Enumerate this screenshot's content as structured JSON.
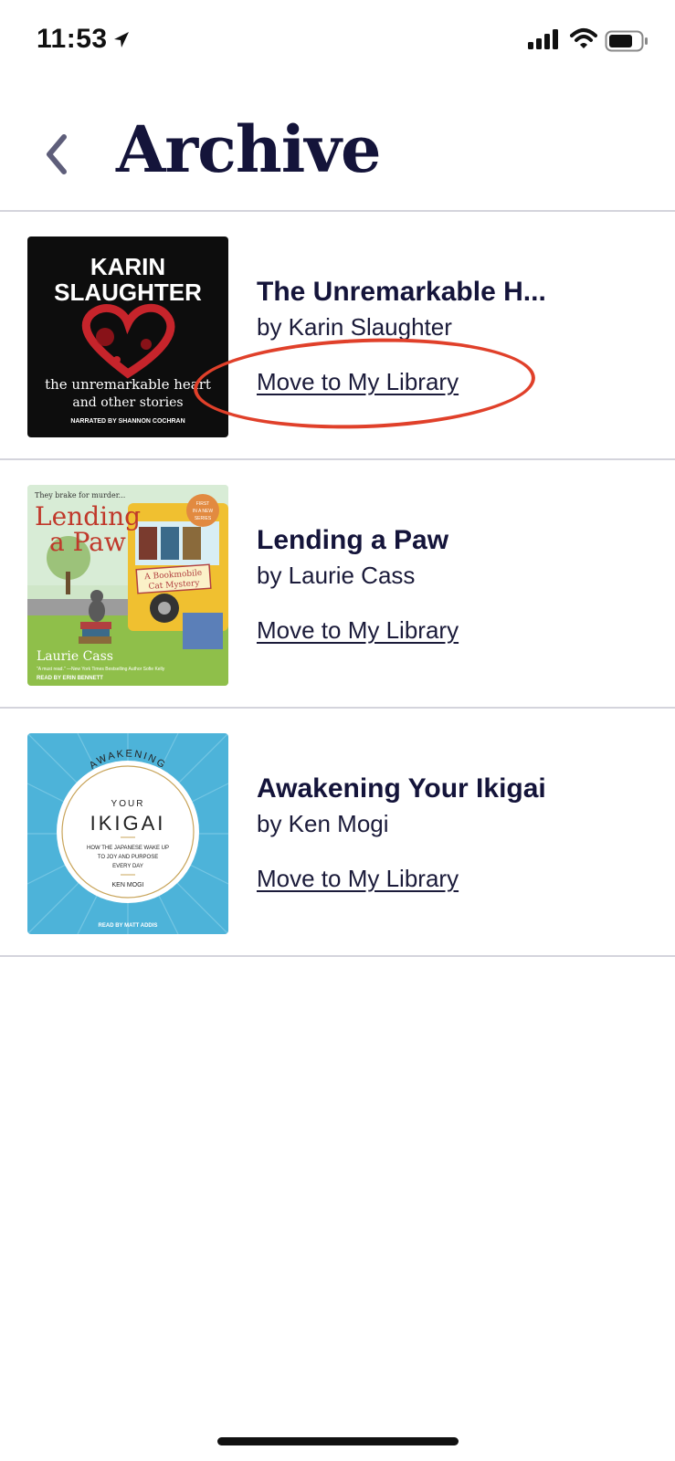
{
  "status_bar": {
    "time": "11:53"
  },
  "header": {
    "title": "Archive"
  },
  "books": [
    {
      "title": "The Unremarkable H...",
      "author": "by Karin Slaughter",
      "action": "Move to My Library",
      "cover": {
        "author_line1": "KARIN",
        "author_line2": "SLAUGHTER",
        "title_line1": "the unremarkable heart",
        "title_line2": "and other stories",
        "narrator": "NARRATED BY SHANNON COCHRAN"
      }
    },
    {
      "title": "Lending a Paw",
      "author": "by Laurie Cass",
      "action": "Move to My Library",
      "cover": {
        "tagline": "They brake for murder...",
        "title_line1": "Lending",
        "title_line2": "a Paw",
        "badge_line1": "FIRST",
        "badge_line2": "IN A NEW",
        "badge_line3": "SERIES",
        "series_line1": "A Bookmobile",
        "series_line2": "Cat Mystery",
        "author": "Laurie Cass",
        "quote": "\"A must read.\" —New York Times Bestselling Author Sofie Kelly",
        "narrator": "READ BY ERIN BENNETT"
      }
    },
    {
      "title": "Awakening Your Ikigai",
      "author": "by Ken Mogi",
      "action": "Move to My Library",
      "cover": {
        "arc_text": "AWAKENING",
        "your": "YOUR",
        "ikigai": "IKIGAI",
        "sub1": "HOW THE JAPANESE WAKE UP",
        "sub2": "TO JOY AND PURPOSE",
        "sub3": "EVERY DAY",
        "author": "KEN MOGI",
        "narrator": "READ BY MATT ADDIS"
      }
    }
  ],
  "colors": {
    "title": "#14143a",
    "annotation": "#e0402a",
    "divider": "#d4d4dc",
    "ikigai_bg": "#4db3d9"
  }
}
